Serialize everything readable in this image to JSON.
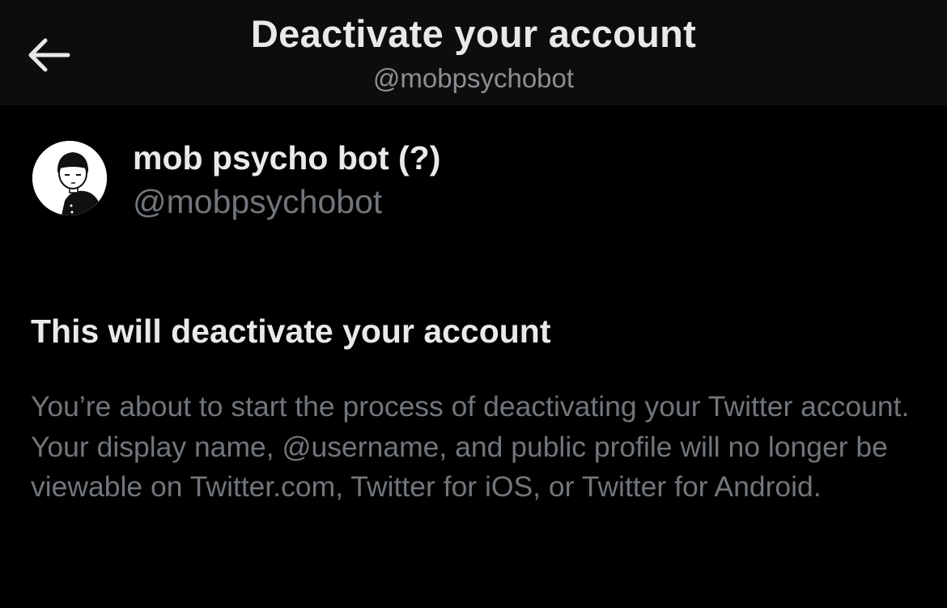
{
  "header": {
    "title": "Deactivate your account",
    "subtitle": "@mobpsychobot",
    "back_icon": "arrow-left-icon"
  },
  "account": {
    "display_name": "mob psycho bot (?)",
    "handle": "@mobpsychobot",
    "avatar_icon": "avatar-image"
  },
  "section": {
    "heading": "This will deactivate your account",
    "body": "You’re about to start the process of deactivating your Twitter account. Your display name, @username, and public profile will no longer be viewable on Twitter.com, Twitter for iOS, or Twitter for Android."
  },
  "colors": {
    "background": "#000000",
    "header_background": "#0d0d0d",
    "primary_text": "#e7e9ea",
    "secondary_text": "#71767b"
  }
}
